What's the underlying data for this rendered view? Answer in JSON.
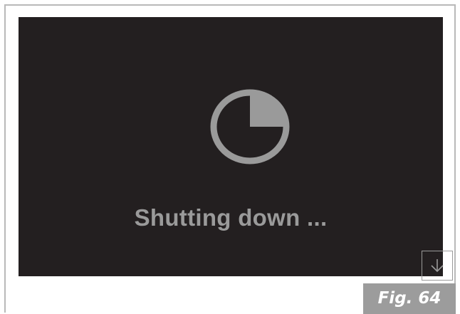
{
  "screen": {
    "status_text": "Shutting down ...",
    "progress_icon": "pie-progress-icon",
    "progress_fraction": 0.25,
    "scroll_down_icon": "arrow-down-icon"
  },
  "figure": {
    "label": "Fig. 64"
  },
  "colors": {
    "screen_background": "#231f20",
    "foreground_gray": "#9a9a9a",
    "label_background": "#9c9c9c",
    "frame_border": "#b9b9b9"
  }
}
